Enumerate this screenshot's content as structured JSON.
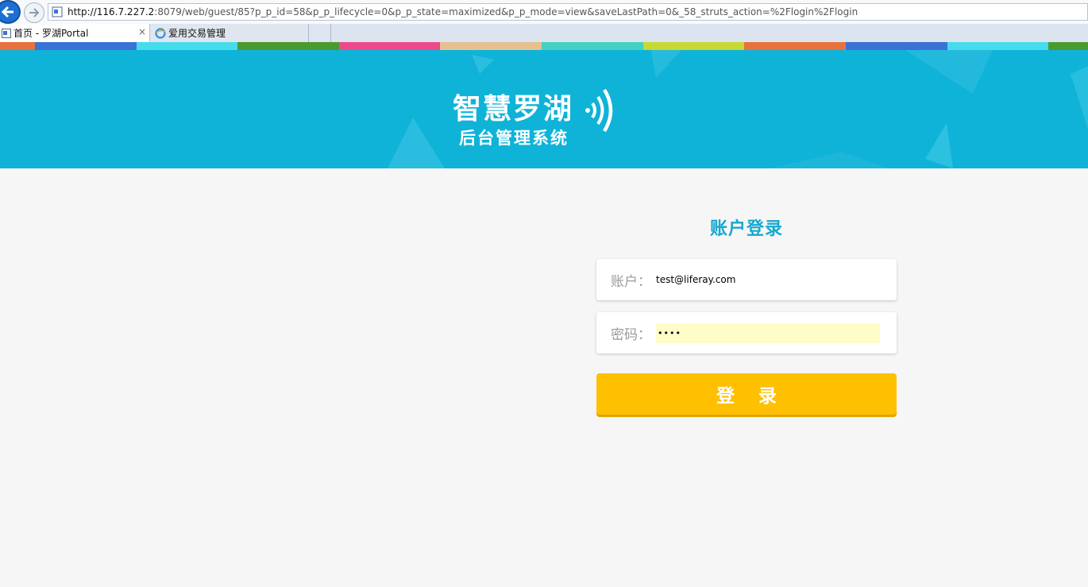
{
  "browser": {
    "url_host": "http://116.7.227.2",
    "url_rest": ":8079/web/guest/85?p_p_id=58&p_p_lifecycle=0&p_p_state=maximized&p_p_mode=view&saveLastPath=0&_58_struts_action=%2Flogin%2Flogin",
    "tabs": [
      {
        "label": "首页 - 罗湖Portal",
        "active": true
      },
      {
        "label": "爱用交易管理",
        "active": false
      }
    ],
    "close_glyph": "×"
  },
  "strip_colors": [
    "#e8723d",
    "#3a72d6",
    "#46dcec",
    "#4a9b2f",
    "#ec4a8c",
    "#e7c08f",
    "#45d1c1",
    "#c6d833",
    "#e8723d",
    "#3a72d6",
    "#46dcec",
    "#4a9b2f"
  ],
  "banner": {
    "logo_title": "智慧罗湖",
    "logo_subtitle": "后台管理系统",
    "background": "#0fb3d8"
  },
  "login": {
    "title": "账户登录",
    "account_label": "账户：",
    "account_value": "test@liferay.com",
    "password_label": "密码：",
    "password_value": "••••",
    "submit_label": "登录",
    "accent": "#fec000",
    "title_color": "#17a8cf"
  }
}
